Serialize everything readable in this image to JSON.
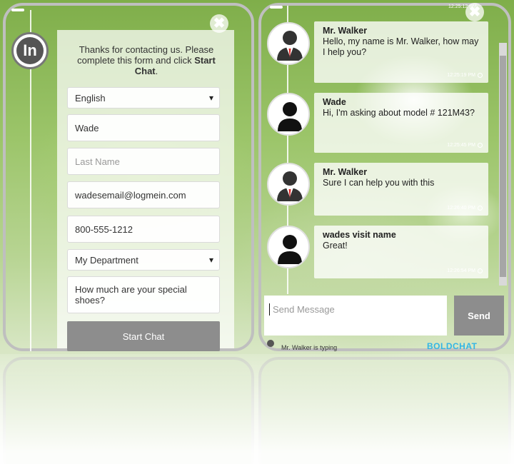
{
  "left_panel": {
    "logo_text": "In",
    "intro_part1": "Thanks for contacting us. Please complete this form and click ",
    "intro_bold": "Start Chat",
    "intro_end": ".",
    "language": "English",
    "first_name": "Wade",
    "last_name_placeholder": "Last Name",
    "email": "wadesemail@logmein.com",
    "phone": "800-555-1212",
    "department": "My Department",
    "question": "How much are your special shoes?",
    "start_chat": "Start Chat"
  },
  "chat": {
    "messages": [
      {
        "sender": "Mr. Walker",
        "text": "Hello, my name is Mr. Walker, how may I help you?",
        "time": "12:25:19 PM",
        "role": "agent"
      },
      {
        "sender": "Wade",
        "text": "Hi, I'm asking about model # 121M43?",
        "time": "12:25:45 PM",
        "role": "visitor"
      },
      {
        "sender": "Mr. Walker",
        "text": "Sure I can help you with this",
        "time": "12:26:40 PM",
        "role": "agent"
      },
      {
        "sender": "wades visit name",
        "text": "Great!",
        "time": "12:26:54 PM",
        "role": "visitor"
      }
    ],
    "top_time": "12:25:12 PM",
    "composer_placeholder": "Send Message",
    "send": "Send",
    "typing": "Mr. Walker is typing",
    "brand": "BOLDCHAT",
    "brand_color": "#33b5e5"
  },
  "close_glyph": "✖"
}
